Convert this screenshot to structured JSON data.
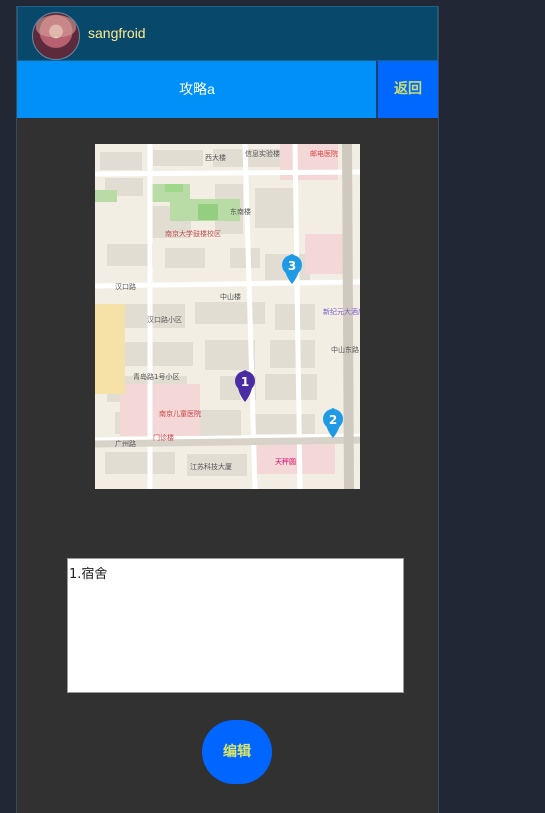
{
  "header": {
    "username": "sangfroid"
  },
  "titlebar": {
    "title": "攻略a",
    "back_label": "返回"
  },
  "map": {
    "markers": [
      {
        "number": "1",
        "color": "#4a2ca3"
      },
      {
        "number": "2",
        "color": "#1f9be5"
      },
      {
        "number": "3",
        "color": "#1f9be5"
      }
    ],
    "labels": {
      "l1": "西大楼",
      "l2": "信息实验楼",
      "l3": "邮电医院",
      "l4": "东南楼",
      "l5": "南京大学鼓楼校区",
      "l6": "广州路",
      "l7": "中山楼",
      "l8": "汉口路小区",
      "l9": "新纪元大酒店",
      "l10": "南京儿童医院",
      "l11": "门诊楼",
      "l12": "江苏科技大厦",
      "l13": "青岛路1号小区",
      "l14": "中山东路",
      "l15": "天秤圆",
      "l16": "汉口路"
    }
  },
  "note": {
    "content": "1.宿舍"
  },
  "actions": {
    "edit_label": "编辑"
  }
}
